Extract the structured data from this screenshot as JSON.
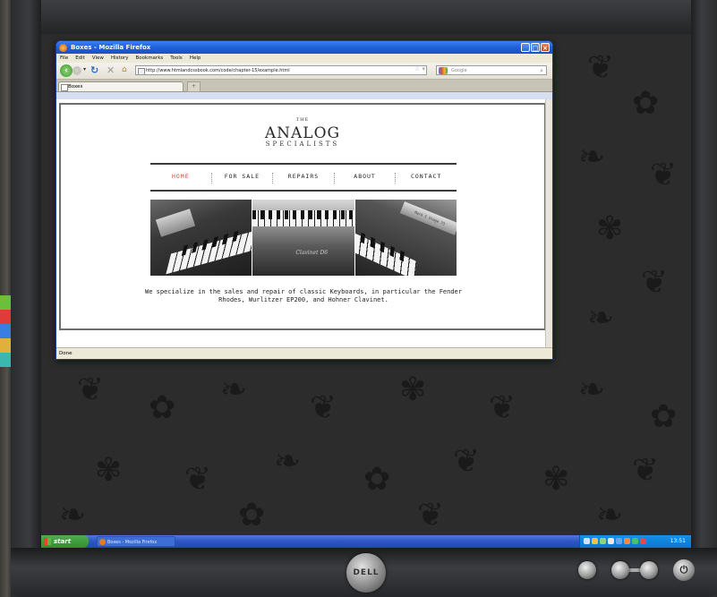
{
  "browser": {
    "window_title": "Boxes - Mozilla Firefox",
    "menus": [
      "File",
      "Edit",
      "View",
      "History",
      "Bookmarks",
      "Tools",
      "Help"
    ],
    "url": "http://www.htmlandcssbook.com/code/chapter-15/example.html",
    "search_placeholder": "Google",
    "tab_title": "Boxes",
    "status": "Done"
  },
  "page": {
    "logo_the": "THE",
    "logo_main": "ANALOG",
    "logo_sub": "SPECIALISTS",
    "nav": [
      "HOME",
      "FOR SALE",
      "REPAIRS",
      "ABOUT",
      "CONTACT"
    ],
    "tagline": "We specialize in the sales and repair of classic Keyboards, in particular the Fender Rhodes, Wurlitzer EP200, and Hohner Clavinet.",
    "photo2_caption": "Clavinet D6",
    "photo3_plate": "Mark I Stage 73"
  },
  "taskbar": {
    "start_label": "start",
    "task_item": "Boxes - Mozilla Firefox",
    "clock": "13:51"
  },
  "monitor": {
    "brand": "DELL"
  },
  "colors": {
    "nav_active": "#d24a3a",
    "titlebar": "#1f5fd8",
    "taskbar": "#2c55c4"
  }
}
